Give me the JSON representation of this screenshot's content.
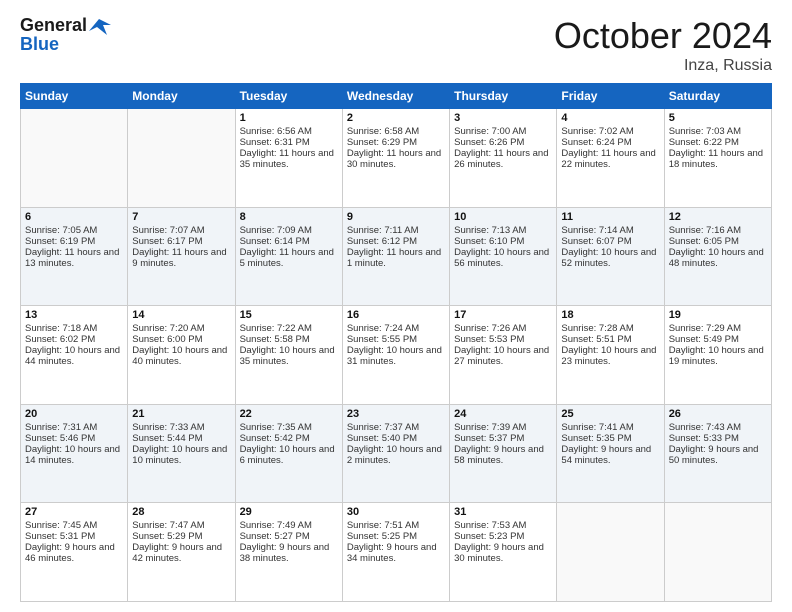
{
  "header": {
    "logo_line1": "General",
    "logo_line2": "Blue",
    "month_title": "October 2024",
    "location": "Inza, Russia"
  },
  "days_of_week": [
    "Sunday",
    "Monday",
    "Tuesday",
    "Wednesday",
    "Thursday",
    "Friday",
    "Saturday"
  ],
  "weeks": [
    [
      {
        "day": "",
        "sunrise": "",
        "sunset": "",
        "daylight": ""
      },
      {
        "day": "",
        "sunrise": "",
        "sunset": "",
        "daylight": ""
      },
      {
        "day": "1",
        "sunrise": "Sunrise: 6:56 AM",
        "sunset": "Sunset: 6:31 PM",
        "daylight": "Daylight: 11 hours and 35 minutes."
      },
      {
        "day": "2",
        "sunrise": "Sunrise: 6:58 AM",
        "sunset": "Sunset: 6:29 PM",
        "daylight": "Daylight: 11 hours and 30 minutes."
      },
      {
        "day": "3",
        "sunrise": "Sunrise: 7:00 AM",
        "sunset": "Sunset: 6:26 PM",
        "daylight": "Daylight: 11 hours and 26 minutes."
      },
      {
        "day": "4",
        "sunrise": "Sunrise: 7:02 AM",
        "sunset": "Sunset: 6:24 PM",
        "daylight": "Daylight: 11 hours and 22 minutes."
      },
      {
        "day": "5",
        "sunrise": "Sunrise: 7:03 AM",
        "sunset": "Sunset: 6:22 PM",
        "daylight": "Daylight: 11 hours and 18 minutes."
      }
    ],
    [
      {
        "day": "6",
        "sunrise": "Sunrise: 7:05 AM",
        "sunset": "Sunset: 6:19 PM",
        "daylight": "Daylight: 11 hours and 13 minutes."
      },
      {
        "day": "7",
        "sunrise": "Sunrise: 7:07 AM",
        "sunset": "Sunset: 6:17 PM",
        "daylight": "Daylight: 11 hours and 9 minutes."
      },
      {
        "day": "8",
        "sunrise": "Sunrise: 7:09 AM",
        "sunset": "Sunset: 6:14 PM",
        "daylight": "Daylight: 11 hours and 5 minutes."
      },
      {
        "day": "9",
        "sunrise": "Sunrise: 7:11 AM",
        "sunset": "Sunset: 6:12 PM",
        "daylight": "Daylight: 11 hours and 1 minute."
      },
      {
        "day": "10",
        "sunrise": "Sunrise: 7:13 AM",
        "sunset": "Sunset: 6:10 PM",
        "daylight": "Daylight: 10 hours and 56 minutes."
      },
      {
        "day": "11",
        "sunrise": "Sunrise: 7:14 AM",
        "sunset": "Sunset: 6:07 PM",
        "daylight": "Daylight: 10 hours and 52 minutes."
      },
      {
        "day": "12",
        "sunrise": "Sunrise: 7:16 AM",
        "sunset": "Sunset: 6:05 PM",
        "daylight": "Daylight: 10 hours and 48 minutes."
      }
    ],
    [
      {
        "day": "13",
        "sunrise": "Sunrise: 7:18 AM",
        "sunset": "Sunset: 6:02 PM",
        "daylight": "Daylight: 10 hours and 44 minutes."
      },
      {
        "day": "14",
        "sunrise": "Sunrise: 7:20 AM",
        "sunset": "Sunset: 6:00 PM",
        "daylight": "Daylight: 10 hours and 40 minutes."
      },
      {
        "day": "15",
        "sunrise": "Sunrise: 7:22 AM",
        "sunset": "Sunset: 5:58 PM",
        "daylight": "Daylight: 10 hours and 35 minutes."
      },
      {
        "day": "16",
        "sunrise": "Sunrise: 7:24 AM",
        "sunset": "Sunset: 5:55 PM",
        "daylight": "Daylight: 10 hours and 31 minutes."
      },
      {
        "day": "17",
        "sunrise": "Sunrise: 7:26 AM",
        "sunset": "Sunset: 5:53 PM",
        "daylight": "Daylight: 10 hours and 27 minutes."
      },
      {
        "day": "18",
        "sunrise": "Sunrise: 7:28 AM",
        "sunset": "Sunset: 5:51 PM",
        "daylight": "Daylight: 10 hours and 23 minutes."
      },
      {
        "day": "19",
        "sunrise": "Sunrise: 7:29 AM",
        "sunset": "Sunset: 5:49 PM",
        "daylight": "Daylight: 10 hours and 19 minutes."
      }
    ],
    [
      {
        "day": "20",
        "sunrise": "Sunrise: 7:31 AM",
        "sunset": "Sunset: 5:46 PM",
        "daylight": "Daylight: 10 hours and 14 minutes."
      },
      {
        "day": "21",
        "sunrise": "Sunrise: 7:33 AM",
        "sunset": "Sunset: 5:44 PM",
        "daylight": "Daylight: 10 hours and 10 minutes."
      },
      {
        "day": "22",
        "sunrise": "Sunrise: 7:35 AM",
        "sunset": "Sunset: 5:42 PM",
        "daylight": "Daylight: 10 hours and 6 minutes."
      },
      {
        "day": "23",
        "sunrise": "Sunrise: 7:37 AM",
        "sunset": "Sunset: 5:40 PM",
        "daylight": "Daylight: 10 hours and 2 minutes."
      },
      {
        "day": "24",
        "sunrise": "Sunrise: 7:39 AM",
        "sunset": "Sunset: 5:37 PM",
        "daylight": "Daylight: 9 hours and 58 minutes."
      },
      {
        "day": "25",
        "sunrise": "Sunrise: 7:41 AM",
        "sunset": "Sunset: 5:35 PM",
        "daylight": "Daylight: 9 hours and 54 minutes."
      },
      {
        "day": "26",
        "sunrise": "Sunrise: 7:43 AM",
        "sunset": "Sunset: 5:33 PM",
        "daylight": "Daylight: 9 hours and 50 minutes."
      }
    ],
    [
      {
        "day": "27",
        "sunrise": "Sunrise: 7:45 AM",
        "sunset": "Sunset: 5:31 PM",
        "daylight": "Daylight: 9 hours and 46 minutes."
      },
      {
        "day": "28",
        "sunrise": "Sunrise: 7:47 AM",
        "sunset": "Sunset: 5:29 PM",
        "daylight": "Daylight: 9 hours and 42 minutes."
      },
      {
        "day": "29",
        "sunrise": "Sunrise: 7:49 AM",
        "sunset": "Sunset: 5:27 PM",
        "daylight": "Daylight: 9 hours and 38 minutes."
      },
      {
        "day": "30",
        "sunrise": "Sunrise: 7:51 AM",
        "sunset": "Sunset: 5:25 PM",
        "daylight": "Daylight: 9 hours and 34 minutes."
      },
      {
        "day": "31",
        "sunrise": "Sunrise: 7:53 AM",
        "sunset": "Sunset: 5:23 PM",
        "daylight": "Daylight: 9 hours and 30 minutes."
      },
      {
        "day": "",
        "sunrise": "",
        "sunset": "",
        "daylight": ""
      },
      {
        "day": "",
        "sunrise": "",
        "sunset": "",
        "daylight": ""
      }
    ]
  ]
}
